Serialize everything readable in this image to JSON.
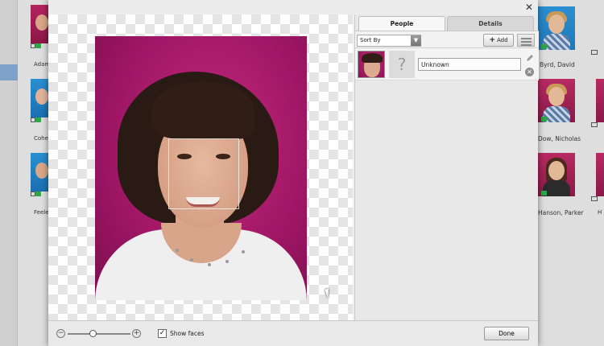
{
  "background": {
    "left_names": [
      "Adam",
      "Cohe",
      "Feele"
    ],
    "right_names": [
      "Byrd, David",
      "Dow, Nicholas",
      "Hanson, Parker"
    ],
    "right_edge_labels": [
      "H"
    ]
  },
  "dialog": {
    "close_label": "✕",
    "tabs": {
      "people": "People",
      "details": "Details"
    },
    "toolbar": {
      "sort_by": "Sort By",
      "add_label": "Add"
    },
    "person": {
      "name_value": "Unknown",
      "unknown_glyph": "?"
    },
    "footer": {
      "zoom_minus": "−",
      "zoom_plus": "+",
      "zoom_level": 0.4,
      "show_faces_label": "Show faces",
      "show_faces_checked": true,
      "checkmark": "✓",
      "done_label": "Done"
    }
  },
  "colors": {
    "portrait_background": "#a21767",
    "blue_thumb": "#2a8fd1",
    "tag_green": "#2fa64a"
  },
  "icons": [
    "close-icon",
    "dropdown-arrow-icon",
    "plus-icon",
    "list-view-icon",
    "question-mark-icon",
    "pencil-icon",
    "remove-icon",
    "zoom-out-icon",
    "zoom-in-icon",
    "checkbox-icon",
    "mouse-cursor-icon"
  ]
}
